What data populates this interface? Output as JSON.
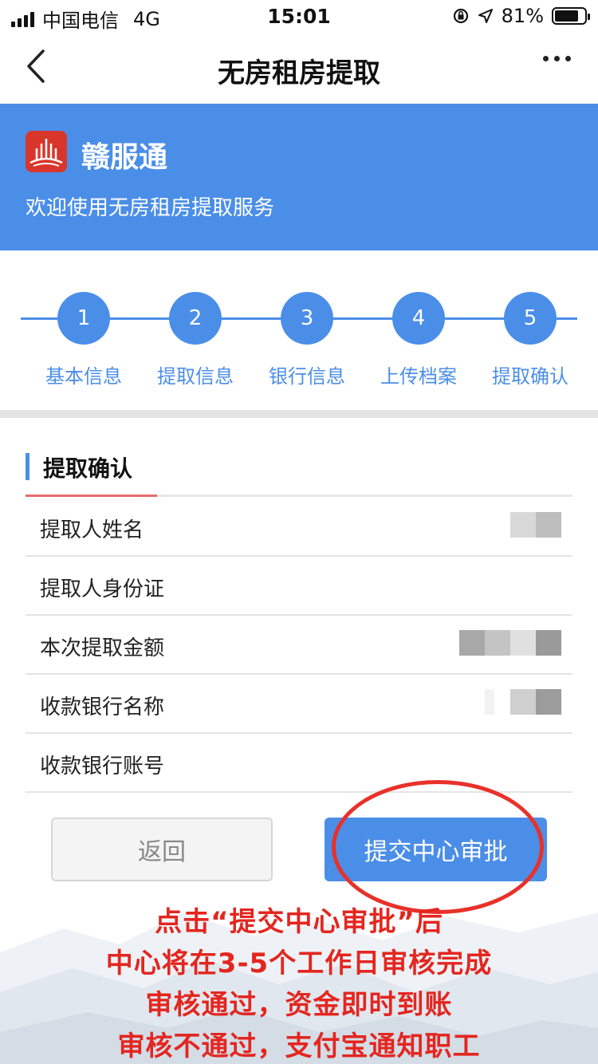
{
  "status_bar": {
    "carrier": "中国电信",
    "network": "4G",
    "time": "15:01",
    "battery": "81%"
  },
  "nav": {
    "title": "无房租房提取",
    "back_icon": "chevron-left-icon",
    "more_icon": "more-dots-icon"
  },
  "banner": {
    "app_name": "赣服通",
    "welcome": "欢迎使用无房租房提取服务"
  },
  "steps": [
    {
      "number": "1",
      "label": "基本信息"
    },
    {
      "number": "2",
      "label": "提取信息"
    },
    {
      "number": "3",
      "label": "银行信息"
    },
    {
      "number": "4",
      "label": "上传档案"
    },
    {
      "number": "5",
      "label": "提取确认"
    }
  ],
  "section": {
    "title": "提取确认"
  },
  "rows": [
    {
      "label": "提取人姓名"
    },
    {
      "label": "提取人身份证"
    },
    {
      "label": "本次提取金额"
    },
    {
      "label": "收款银行名称"
    },
    {
      "label": "收款银行账号"
    }
  ],
  "buttons": {
    "back": "返回",
    "submit": "提交中心审批"
  },
  "notice": [
    "点击“提交中心审批”后",
    "中心将在3-5个工作日审核完成",
    "审核通过，资金即时到账",
    "审核不通过，支付宝通知职工"
  ],
  "colors": {
    "primary": "#4b8ee8",
    "alert": "#e3261f"
  }
}
